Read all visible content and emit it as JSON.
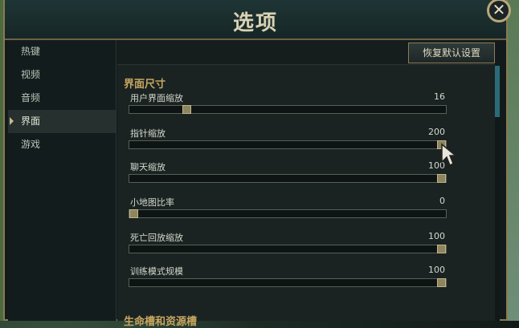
{
  "window": {
    "title": "选项",
    "close_label": "✕"
  },
  "sidebar": {
    "items": [
      {
        "label": "热键",
        "active": false
      },
      {
        "label": "视频",
        "active": false
      },
      {
        "label": "音频",
        "active": false
      },
      {
        "label": "界面",
        "active": true
      },
      {
        "label": "游戏",
        "active": false
      }
    ]
  },
  "toolbar": {
    "reset_label": "恢复默认设置"
  },
  "section": {
    "title": "界面尺寸",
    "settings": [
      {
        "label": "用户界面缩放",
        "value": "16",
        "fraction": 0.18
      },
      {
        "label": "指针缩放",
        "value": "200",
        "fraction": 1.0
      },
      {
        "label": "聊天缩放",
        "value": "100",
        "fraction": 1.0
      },
      {
        "label": "小地图比率",
        "value": "0",
        "fraction": 0.0
      },
      {
        "label": "死亡回放缩放",
        "value": "100",
        "fraction": 1.0
      },
      {
        "label": "训练模式规模",
        "value": "100",
        "fraction": 1.0
      }
    ]
  },
  "next_section": {
    "title": "生命槽和资源槽"
  },
  "colors": {
    "accent_gold": "#c7a661",
    "frame_gold": "#8a7a52",
    "scrollbar": "#2b6b78"
  }
}
